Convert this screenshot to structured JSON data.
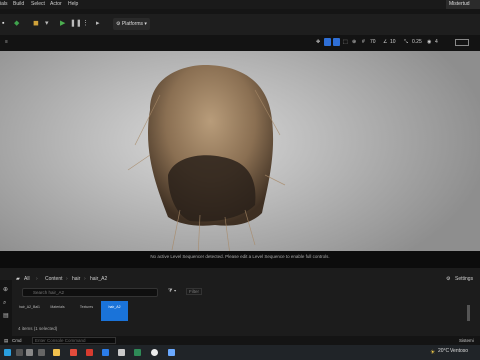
{
  "menubar": {
    "items": [
      "ials",
      "Build",
      "Select",
      "Actor",
      "Help"
    ],
    "window_title": "Mistertud"
  },
  "toolbar": {
    "platforms_label": "Platforms"
  },
  "viewport": {
    "stat_1": "70",
    "stat_2": "10",
    "stat_3": "0.25",
    "stat_4": "4",
    "sequence_message": "No active Level Sequencer detected. Please edit a Level Sequence to enable full controls."
  },
  "content_browser": {
    "breadcrumbs": [
      "All",
      "Content",
      "hair",
      "hair_A2"
    ],
    "settings_label": "Settings",
    "search_placeholder": "Search hair_A2",
    "filter_label": "Filter",
    "assets": [
      {
        "label": "hair_A2_Bal1",
        "selected": false
      },
      {
        "label": "Materials",
        "selected": false
      },
      {
        "label": "Textures",
        "selected": false
      },
      {
        "label": "hair_A2",
        "selected": true
      }
    ],
    "item_count": "4 items (1 selected)"
  },
  "cmd": {
    "mode_label": "Cmd",
    "placeholder": "Enter Console Command"
  },
  "taskbar": {
    "temperature": "20°C",
    "weather": "Ventoso"
  }
}
